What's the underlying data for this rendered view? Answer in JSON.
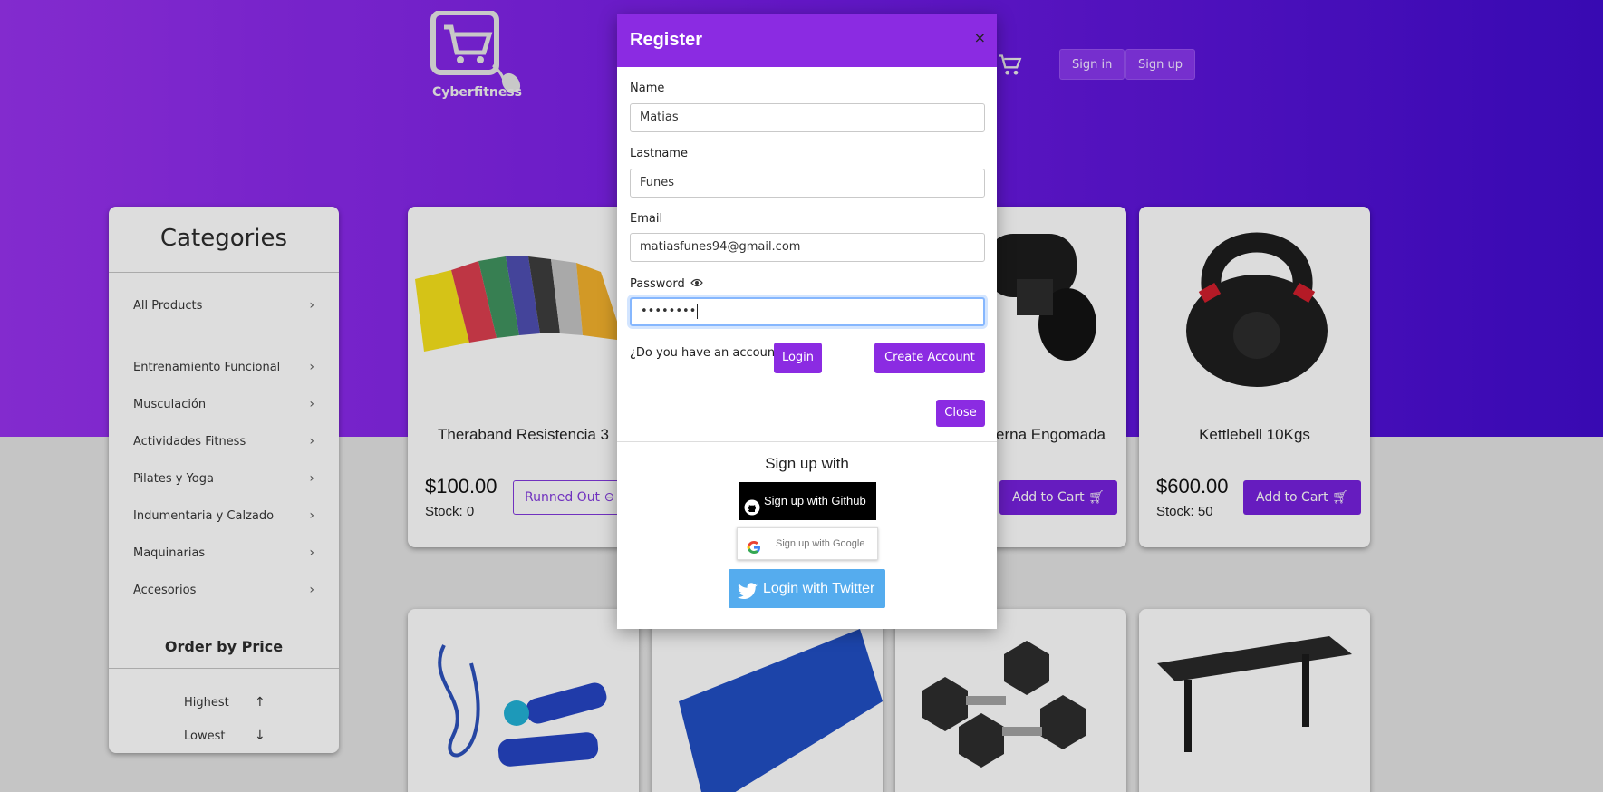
{
  "brand": {
    "name": "Cyberfitness"
  },
  "nav": {
    "signin_label": "Sign in",
    "signup_label": "Sign up"
  },
  "sidebar": {
    "title": "Categories",
    "items": [
      {
        "label": "All Products"
      },
      {
        "label": "Entrenamiento Funcional"
      },
      {
        "label": "Musculación"
      },
      {
        "label": "Actividades Fitness"
      },
      {
        "label": "Pilates y Yoga"
      },
      {
        "label": "Indumentaria y Calzado"
      },
      {
        "label": "Maquinarias"
      },
      {
        "label": "Accesorios"
      }
    ],
    "order_title": "Order by Price",
    "order_items": [
      {
        "label": "Highest"
      },
      {
        "label": "Lowest"
      }
    ]
  },
  "products": [
    {
      "title": "Theraband Resistencia 3",
      "price": "$100.00",
      "stock": "Stock: 0",
      "button": "Runned Out"
    },
    {
      "title": "Mancuerna Engomada 5Kgs",
      "button": "Add to Cart"
    },
    {
      "title": "Kettlebell 10Kgs",
      "price": "$600.00",
      "stock": "Stock: 50",
      "button": "Add to Cart"
    }
  ],
  "modal": {
    "title": "Register",
    "close_x": "×",
    "fields": {
      "name": {
        "label": "Name",
        "value": "Matias"
      },
      "lastname": {
        "label": "Lastname",
        "value": "Funes"
      },
      "email": {
        "label": "Email",
        "value": "matiasfunes94@gmail.com"
      },
      "password": {
        "label": "Password",
        "value": "••••••••"
      }
    },
    "have_account": "¿Do you have an account?",
    "login_label": "Login",
    "create_label": "Create Account",
    "close_label": "Close",
    "signup_with": "Sign up with",
    "github_label": "Sign up with Github",
    "google_label": "Sign up with Google",
    "twitter_label": "Login with Twitter"
  },
  "colors": {
    "primary": "#8b2be2",
    "accent": "#6f1fd0",
    "twitter": "#55acee"
  }
}
